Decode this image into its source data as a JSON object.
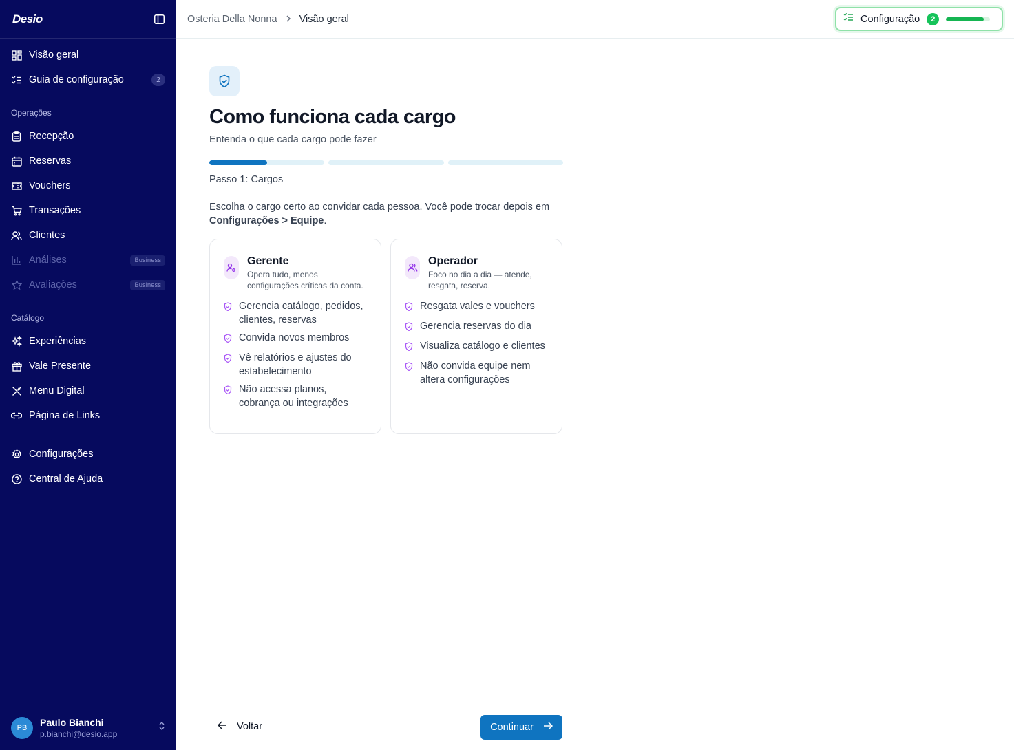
{
  "sidebar": {
    "logo": "Desio",
    "top_items": [
      {
        "label": "Visão geral"
      },
      {
        "label": "Guia de configuração",
        "badge": "2"
      }
    ],
    "operations_title": "Operações",
    "operations": [
      {
        "label": "Recepção"
      },
      {
        "label": "Reservas"
      },
      {
        "label": "Vouchers"
      },
      {
        "label": "Transações"
      },
      {
        "label": "Clientes"
      },
      {
        "label": "Análises",
        "badge": "Business"
      },
      {
        "label": "Avaliações",
        "badge": "Business"
      }
    ],
    "catalog_title": "Catálogo",
    "catalog": [
      {
        "label": "Experiências"
      },
      {
        "label": "Vale Presente"
      },
      {
        "label": "Menu Digital"
      },
      {
        "label": "Página de Links"
      }
    ],
    "bottom_items": [
      {
        "label": "Configurações"
      },
      {
        "label": "Central de Ajuda"
      }
    ],
    "user": {
      "initials": "PB",
      "name": "Paulo Bianchi",
      "email": "p.bianchi@desio.app"
    }
  },
  "topbar": {
    "breadcrumb": [
      "Osteria Della Nonna",
      "Visão geral"
    ],
    "setup": {
      "label": "Configuração",
      "count": "2",
      "progress": 0.85
    }
  },
  "main": {
    "title": "Como funciona cada cargo",
    "subtitle": "Entenda o que cada cargo pode fazer",
    "steps_total": 3,
    "step_progress": [
      0.5,
      0,
      0
    ],
    "step_label": "Passo 1: Cargos",
    "intro_text": "Escolha o cargo certo ao convidar cada pessoa. Você pode trocar depois em ",
    "intro_bold": "Configurações > Equipe",
    "intro_end": ".",
    "cards": [
      {
        "title": "Gerente",
        "desc": "Opera tudo, menos configurações críticas da conta.",
        "features": [
          "Gerencia catálogo, pedidos, clientes, reservas",
          "Convida novos membros",
          "Vê relatórios e ajustes do estabelecimento",
          "Não acessa planos, cobrança ou integrações"
        ]
      },
      {
        "title": "Operador",
        "desc": "Foco no dia a dia — atende, resgata, reserva.",
        "features": [
          "Resgata vales e vouchers",
          "Gerencia reservas do dia",
          "Visualiza catálogo e clientes",
          "Não convida equipe nem altera configurações"
        ]
      }
    ]
  },
  "footer": {
    "back_label": "Voltar",
    "continue_label": "Continuar"
  },
  "colors": {
    "sidebar": "#060a5e",
    "primary": "#0f74c0",
    "success": "#16c35a"
  }
}
